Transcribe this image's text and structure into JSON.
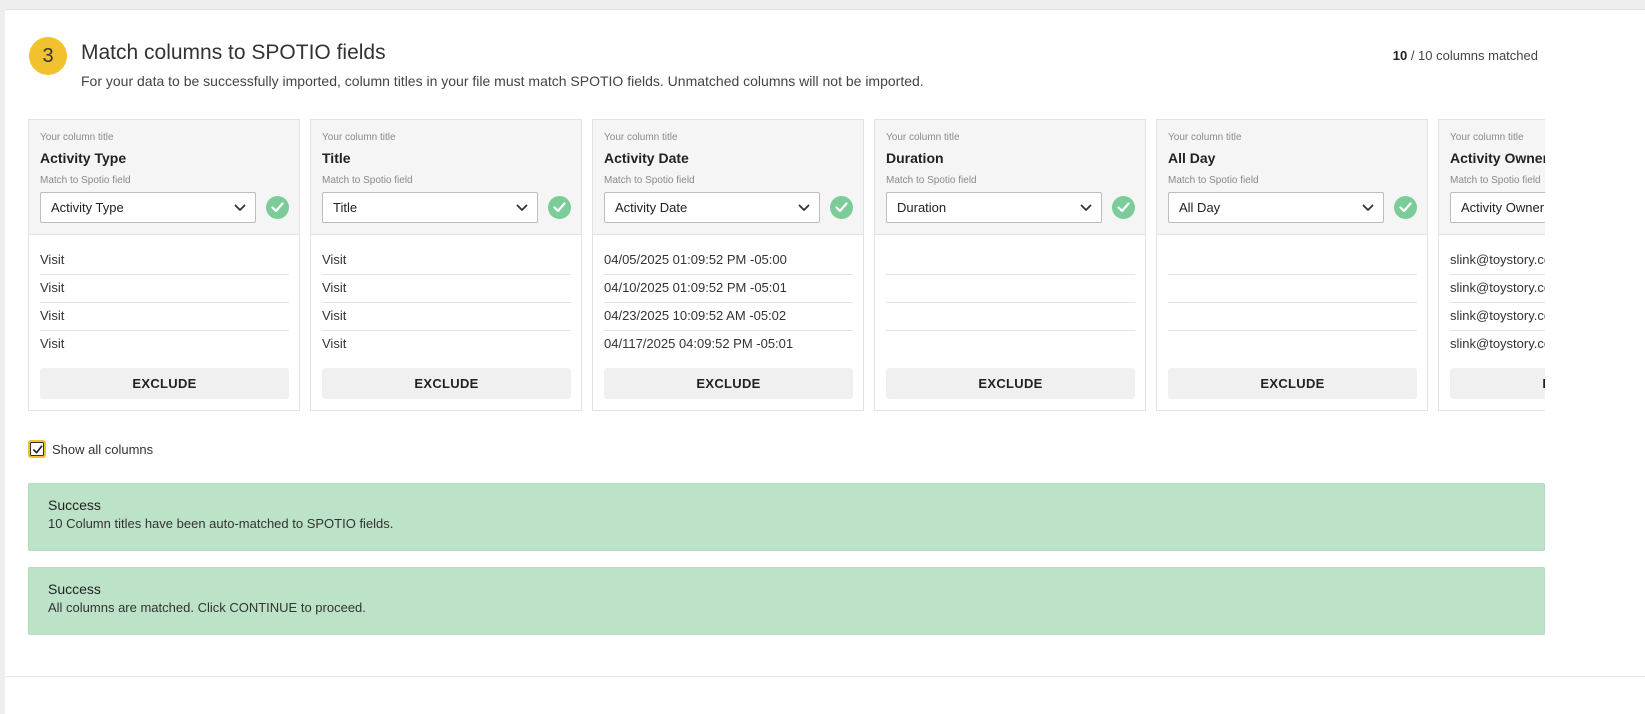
{
  "header": {
    "step_number": "3",
    "title": "Match columns to SPOTIO fields",
    "subtitle": "For your data to be successfully imported, column titles in your file must match SPOTIO fields. Unmatched columns will not be imported.",
    "matched_count": "10",
    "matched_suffix": "/ 10 columns matched"
  },
  "columns": [
    {
      "your_label": "Your column title",
      "title": "Activity Type",
      "match_label": "Match to Spotio field",
      "field": "Activity Type",
      "values": [
        "Visit",
        "Visit",
        "Visit",
        "Visit"
      ],
      "exclude_label": "EXCLUDE"
    },
    {
      "your_label": "Your column title",
      "title": "Title",
      "match_label": "Match to Spotio field",
      "field": "Title",
      "values": [
        "Visit",
        "Visit",
        "Visit",
        "Visit"
      ],
      "exclude_label": "EXCLUDE"
    },
    {
      "your_label": "Your column title",
      "title": "Activity Date",
      "match_label": "Match to Spotio field",
      "field": "Activity Date",
      "values": [
        "04/05/2025 01:09:52 PM -05:00",
        "04/10/2025 01:09:52 PM -05:01",
        "04/23/2025 10:09:52 AM -05:02",
        "04/117/2025 04:09:52 PM -05:01"
      ],
      "exclude_label": "EXCLUDE"
    },
    {
      "your_label": "Your column title",
      "title": "Duration",
      "match_label": "Match to Spotio field",
      "field": "Duration",
      "values": [
        "",
        "",
        "",
        ""
      ],
      "exclude_label": "EXCLUDE"
    },
    {
      "your_label": "Your column title",
      "title": "All Day",
      "match_label": "Match to Spotio field",
      "field": "All Day",
      "values": [
        "",
        "",
        "",
        ""
      ],
      "exclude_label": "EXCLUDE"
    },
    {
      "your_label": "Your column title",
      "title": "Activity Owner",
      "match_label": "Match to Spotio field",
      "field": "Activity Owner",
      "values": [
        "slink@toystory.com",
        "slink@toystory.com",
        "slink@toystory.com",
        "slink@toystory.com"
      ],
      "exclude_label": "EXCLUDE"
    }
  ],
  "show_all": {
    "label": "Show all columns",
    "checked": true
  },
  "alerts": [
    {
      "title": "Success",
      "body": "10 Column titles have been auto-matched to SPOTIO fields."
    },
    {
      "title": "Success",
      "body": "All columns are matched. Click CONTINUE to proceed."
    }
  ],
  "colors": {
    "accent": "#f2c12e",
    "success_check": "#7ccc9a",
    "alert_bg": "#bce2c7"
  }
}
